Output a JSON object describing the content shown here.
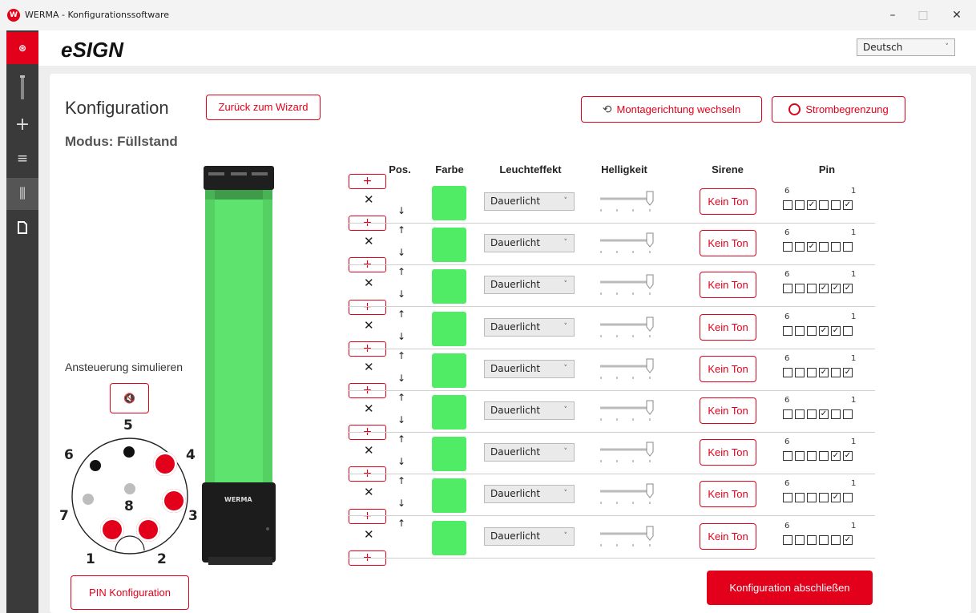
{
  "window": {
    "title": "WERMA - Konfigurationssoftware",
    "logo_text": "W",
    "minimize": "–",
    "maximize": "□",
    "close": "✕"
  },
  "sidebar": {
    "items": [
      {
        "icon": "werma-logo-icon",
        "glyph": "⊛"
      },
      {
        "icon": "tower-icon",
        "glyph": "▮"
      },
      {
        "icon": "plus-icon",
        "glyph": "+"
      },
      {
        "icon": "list-icon",
        "glyph": "≡"
      },
      {
        "icon": "sliders-icon",
        "glyph": "⫼"
      },
      {
        "icon": "document-icon",
        "glyph": "🗋"
      }
    ]
  },
  "header": {
    "brand": "eSIGN",
    "language": "Deutsch"
  },
  "page": {
    "title": "Konfiguration",
    "back_button": "Zurück zum Wizard",
    "mode": "Modus: Füllstand",
    "mount_button": "Montagerichtung wechseln",
    "current_button": "Strombegrenzung",
    "simulate_label": "Ansteuerung simulieren",
    "mute_glyph": "🔇",
    "pin_config_button": "PIN Konfiguration",
    "finish_button": "Konfiguration abschließen",
    "tower_brand": "WERMA"
  },
  "connector": {
    "pins": [
      {
        "n": "5",
        "state": "black"
      },
      {
        "n": "6",
        "state": "black"
      },
      {
        "n": "4",
        "state": "red"
      },
      {
        "n": "3",
        "state": "red"
      },
      {
        "n": "7",
        "state": "gray"
      },
      {
        "n": "8",
        "state": "gray"
      },
      {
        "n": "1",
        "state": "red"
      },
      {
        "n": "2",
        "state": "red"
      }
    ]
  },
  "table": {
    "headers": {
      "pos": "Pos.",
      "farbe": "Farbe",
      "leuchteffekt": "Leuchteffekt",
      "helligkeit": "Helligkeit",
      "sirene": "Sirene",
      "pin": "Pin"
    },
    "plus": "+",
    "remove": "✕",
    "up": "↑",
    "down": "↓",
    "color": "#50ec65",
    "pin_left": "6",
    "pin_right": "1",
    "rows": [
      {
        "effect": "Dauerlicht",
        "siren": "Kein Ton",
        "pins": [
          false,
          false,
          true,
          false,
          false,
          true
        ]
      },
      {
        "effect": "Dauerlicht",
        "siren": "Kein Ton",
        "pins": [
          false,
          false,
          true,
          false,
          false,
          false
        ]
      },
      {
        "effect": "Dauerlicht",
        "siren": "Kein Ton",
        "pins": [
          false,
          false,
          false,
          true,
          true,
          true
        ]
      },
      {
        "effect": "Dauerlicht",
        "siren": "Kein Ton",
        "pins": [
          false,
          false,
          false,
          true,
          true,
          false
        ]
      },
      {
        "effect": "Dauerlicht",
        "siren": "Kein Ton",
        "pins": [
          false,
          false,
          false,
          true,
          false,
          true
        ]
      },
      {
        "effect": "Dauerlicht",
        "siren": "Kein Ton",
        "pins": [
          false,
          false,
          false,
          true,
          false,
          false
        ]
      },
      {
        "effect": "Dauerlicht",
        "siren": "Kein Ton",
        "pins": [
          false,
          false,
          false,
          false,
          true,
          true
        ]
      },
      {
        "effect": "Dauerlicht",
        "siren": "Kein Ton",
        "pins": [
          false,
          false,
          false,
          false,
          true,
          false
        ]
      },
      {
        "effect": "Dauerlicht",
        "siren": "Kein Ton",
        "pins": [
          false,
          false,
          false,
          false,
          false,
          true
        ]
      }
    ]
  }
}
